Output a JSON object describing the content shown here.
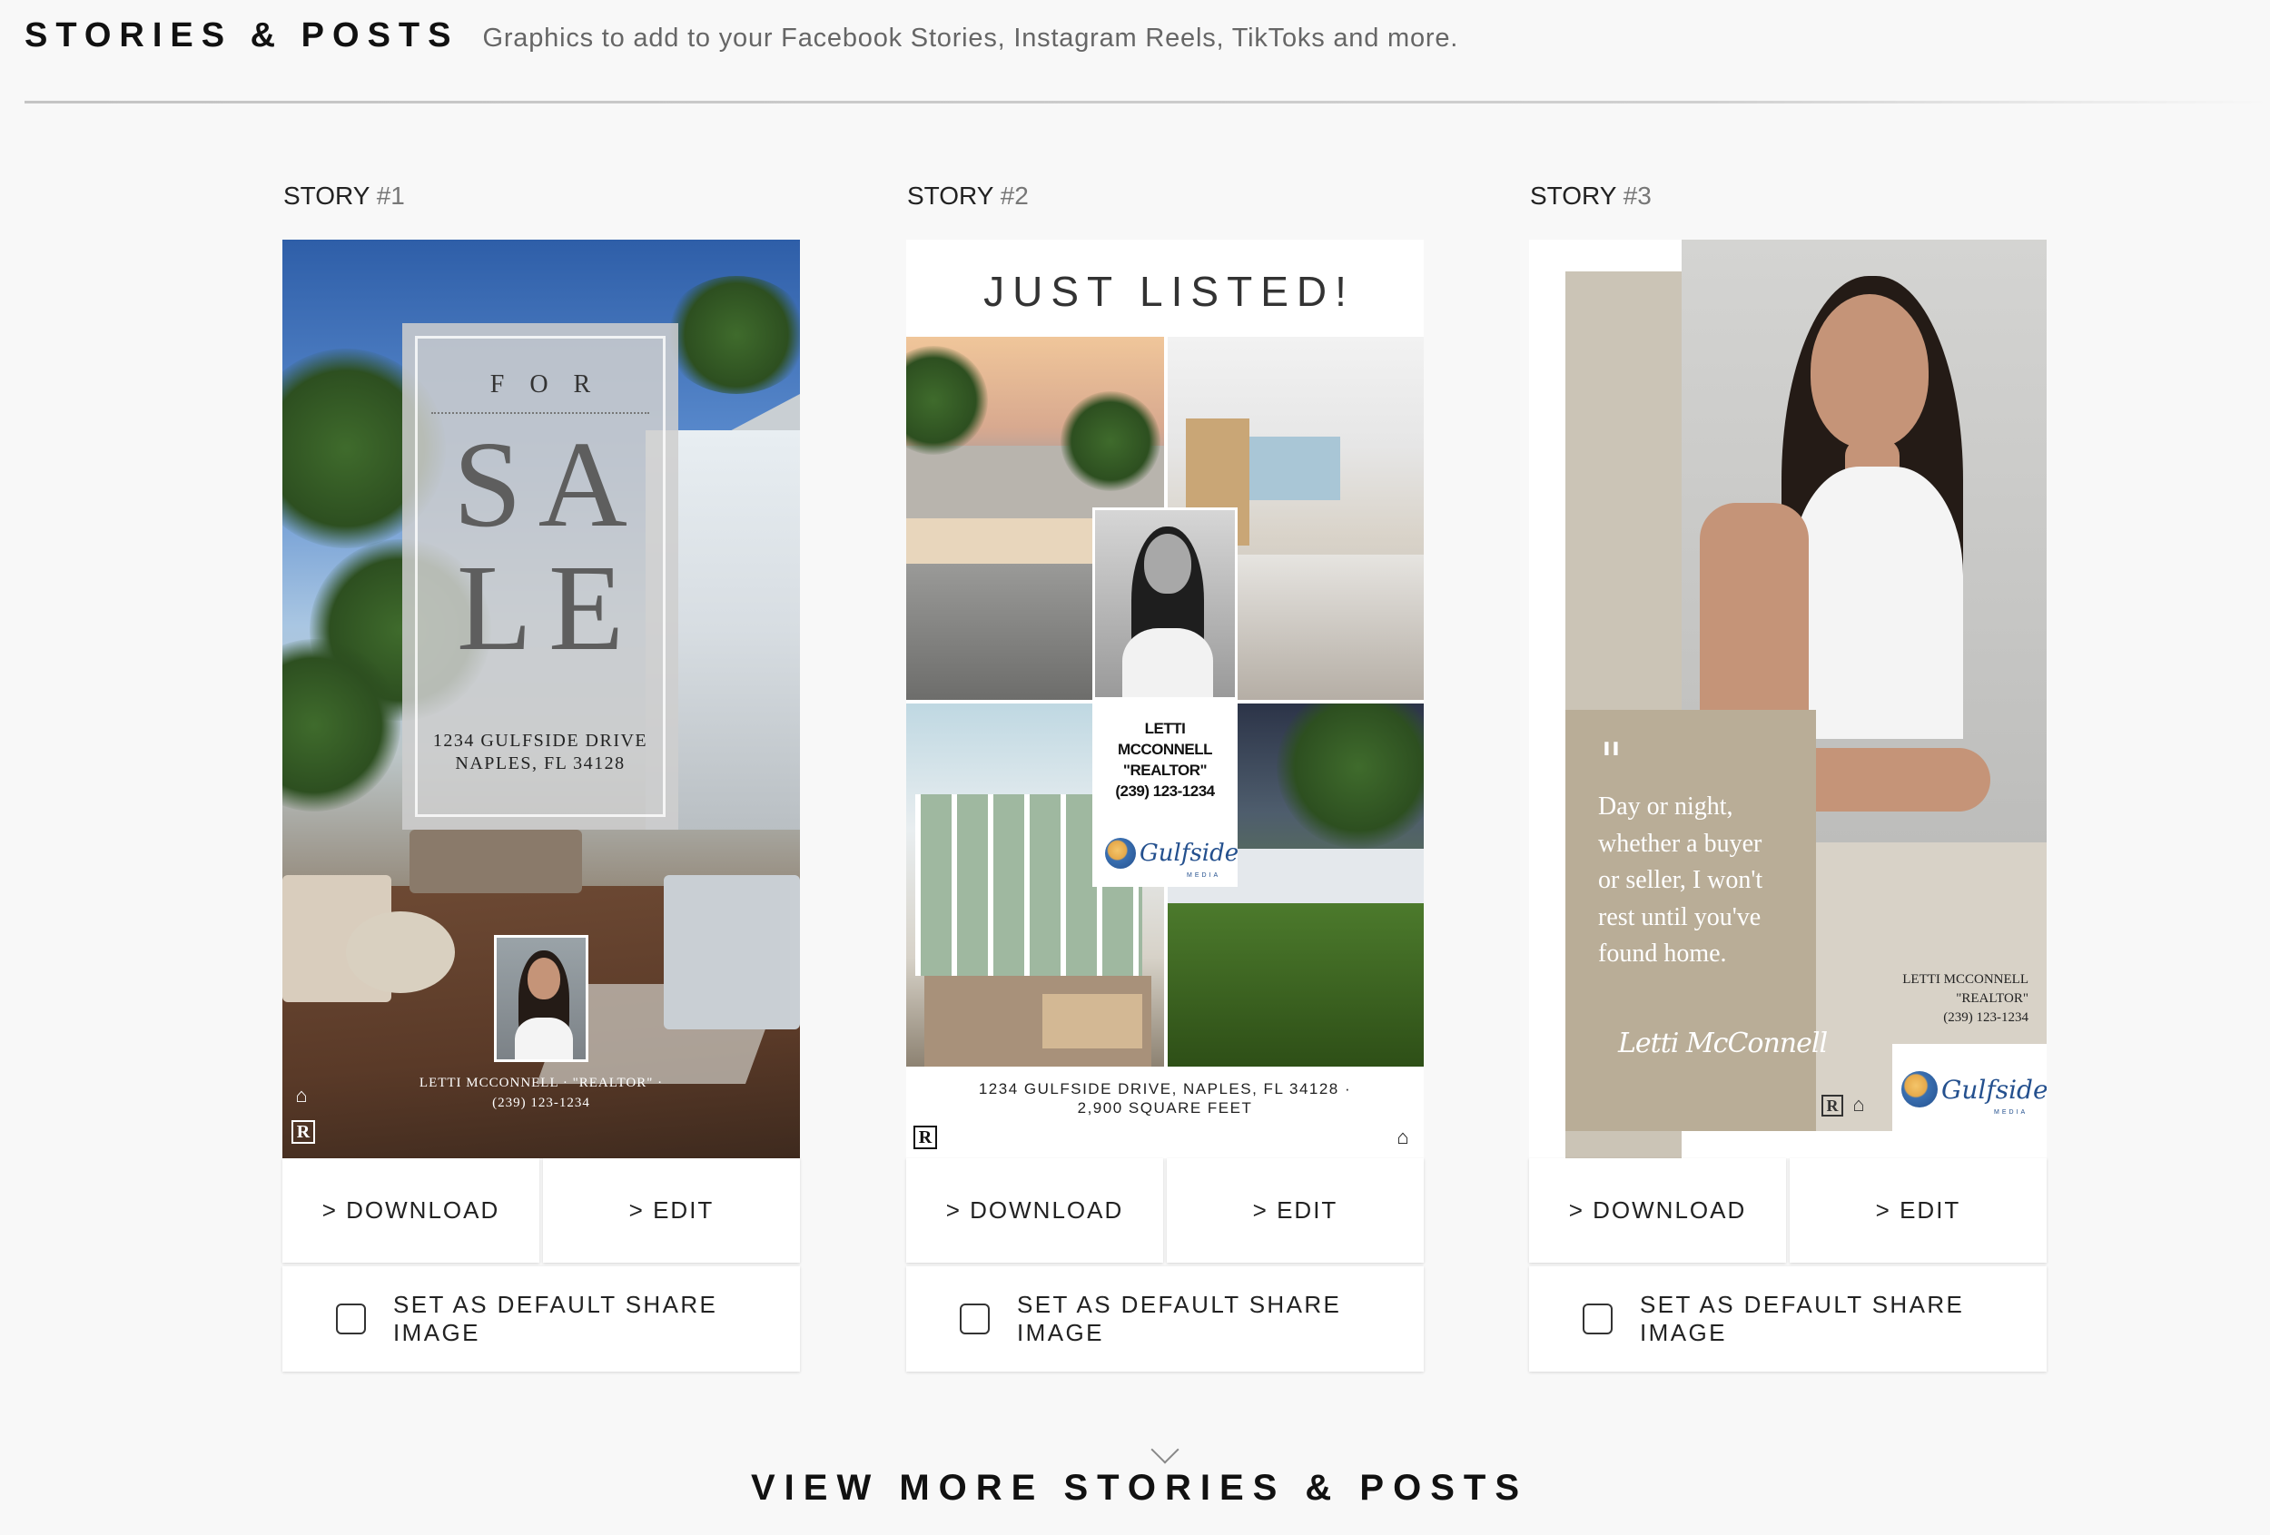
{
  "header": {
    "title": "STORIES & POSTS",
    "subtitle": "Graphics to add to your Facebook Stories, Instagram Reels, TikToks and more."
  },
  "stories": [
    {
      "label_prefix": "STORY",
      "label_num": "#1",
      "download_label": "> DOWNLOAD",
      "edit_label": "> EDIT",
      "default_label": "SET AS DEFAULT SHARE IMAGE",
      "graphic": {
        "for_text": "FOR",
        "sale_line1": "SA",
        "sale_line2": "LE",
        "address_line1": "1234 GULFSIDE DRIVE",
        "address_line2": "NAPLES, FL 34128",
        "agent_line1": "LETTI MCCONNELL · \"REALTOR\" ·",
        "agent_line2": "(239) 123-1234"
      }
    },
    {
      "label_prefix": "STORY",
      "label_num": "#2",
      "download_label": "> DOWNLOAD",
      "edit_label": "> EDIT",
      "default_label": "SET AS DEFAULT SHARE IMAGE",
      "graphic": {
        "title": "JUST LISTED!",
        "agent_line1": "LETTI",
        "agent_line2": "MCCONNELL",
        "agent_line3": "\"REALTOR\"",
        "agent_line4": "(239) 123-1234",
        "logo_text": "Gulfside",
        "logo_sub": "MEDIA",
        "footer_line1": "1234 GULFSIDE DRIVE, NAPLES, FL 34128 ·",
        "footer_line2": "2,900 SQUARE FEET"
      }
    },
    {
      "label_prefix": "STORY",
      "label_num": "#3",
      "download_label": "> DOWNLOAD",
      "edit_label": "> EDIT",
      "default_label": "SET AS DEFAULT SHARE IMAGE",
      "graphic": {
        "quote_mark": "\"",
        "quote": "Day or night, whether a buyer or seller, I won't rest until you've found home.",
        "signature": "Letti McConnell",
        "agent_line1": "LETTI MCCONNELL",
        "agent_line2": "\"REALTOR\"",
        "agent_line3": "(239) 123-1234",
        "logo_text": "Gulfside",
        "logo_sub": "MEDIA"
      }
    }
  ],
  "footer": {
    "view_more_label": "VIEW MORE STORIES & POSTS"
  },
  "icons": {
    "equal_housing": "equal-housing-icon",
    "realtor": "realtor-icon",
    "chevron": "chevron-down-icon",
    "checkbox": "checkbox-icon"
  }
}
